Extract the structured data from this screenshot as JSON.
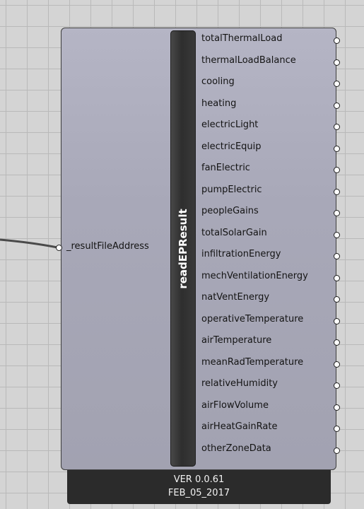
{
  "component": {
    "name": "readEPResult",
    "input": {
      "label": "_resultFileAddress"
    },
    "outputs": [
      {
        "label": "totalThermalLoad"
      },
      {
        "label": "thermalLoadBalance"
      },
      {
        "label": "cooling"
      },
      {
        "label": "heating"
      },
      {
        "label": "electricLight"
      },
      {
        "label": "electricEquip"
      },
      {
        "label": "fanElectric"
      },
      {
        "label": "pumpElectric"
      },
      {
        "label": "peopleGains"
      },
      {
        "label": "totalSolarGain"
      },
      {
        "label": "infiltrationEnergy"
      },
      {
        "label": "mechVentilationEnergy"
      },
      {
        "label": "natVentEnergy"
      },
      {
        "label": "operativeTemperature"
      },
      {
        "label": "airTemperature"
      },
      {
        "label": "meanRadTemperature"
      },
      {
        "label": "relativeHumidity"
      },
      {
        "label": "airFlowVolume"
      },
      {
        "label": "airHeatGainRate"
      },
      {
        "label": "otherZoneData"
      }
    ],
    "version": "VER 0.0.61",
    "date": "FEB_05_2017"
  },
  "colors": {
    "canvas": "#d4d4d4",
    "grid": "#b9b9b9",
    "component_body": "#a8a8b8",
    "name_bar": "#333333",
    "version_bar": "#2b2b2b"
  }
}
